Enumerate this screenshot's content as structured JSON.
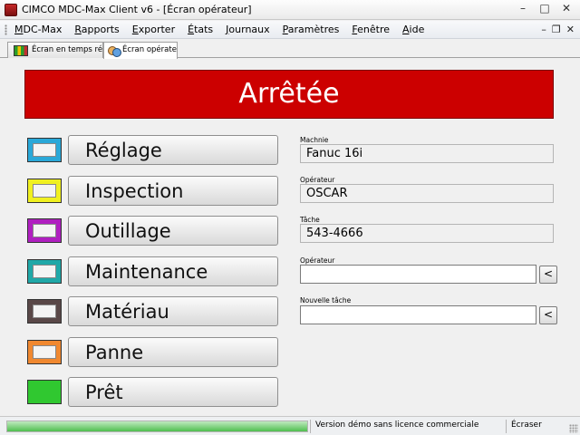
{
  "window": {
    "title": "CIMCO MDC-Max Client v6 - [Écran opérateur]",
    "minimize_glyph": "–",
    "maximize_glyph": "□",
    "close_glyph": "✕"
  },
  "menu": {
    "items": [
      "MDC-Max",
      "Rapports",
      "Exporter",
      "États",
      "Journaux",
      "Paramètres",
      "Fenêtre",
      "Aide"
    ],
    "mdi_minimize": "–",
    "mdi_restore": "❐",
    "mdi_close": "✕"
  },
  "tabs": [
    {
      "label": "Écran en temps réel",
      "icon": "chart-icon"
    },
    {
      "label": "Écran opérateur",
      "icon": "operators-icon"
    }
  ],
  "status_banner": {
    "text": "Arrêtée",
    "color": "#cc0000"
  },
  "states": [
    {
      "label": "Réglage",
      "color": "#2aa8d8"
    },
    {
      "label": "Inspection",
      "color": "#f0f020"
    },
    {
      "label": "Outillage",
      "color": "#b020c0"
    },
    {
      "label": "Maintenance",
      "color": "#20a8a8"
    },
    {
      "label": "Matériau",
      "color": "#5a4848"
    },
    {
      "label": "Panne",
      "color": "#f08830"
    },
    {
      "label": "Prêt",
      "color": "#30c830"
    }
  ],
  "fields": {
    "machine_label": "Machnie",
    "machine_value": "Fanuc 16i",
    "operator_label": "Opérateur",
    "operator_value": "OSCAR",
    "task_label": "Tâche",
    "task_value": "543-4666",
    "operator_input_label": "Opérateur",
    "operator_input_value": "",
    "new_task_label": "Nouvelle tâche",
    "new_task_value": "",
    "pick_button": "<"
  },
  "statusbar": {
    "progress": 1.0,
    "license_text": "Version démo sans licence commerciale",
    "mode_text": "Écraser"
  }
}
